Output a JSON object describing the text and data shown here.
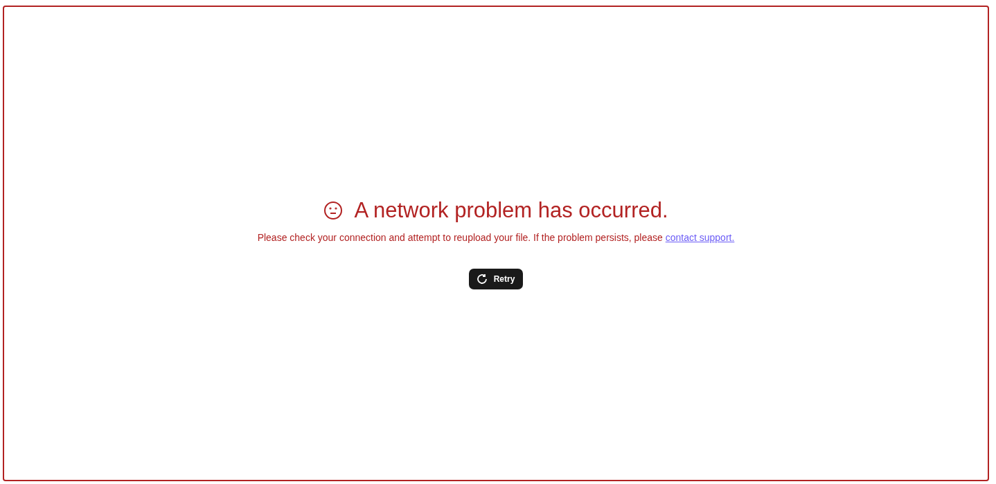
{
  "error": {
    "title": "A network problem has occurred.",
    "message": "Please check your connection and attempt to reupload your file. If the problem persists, please ",
    "link": "contact support.",
    "button": "Retry"
  }
}
